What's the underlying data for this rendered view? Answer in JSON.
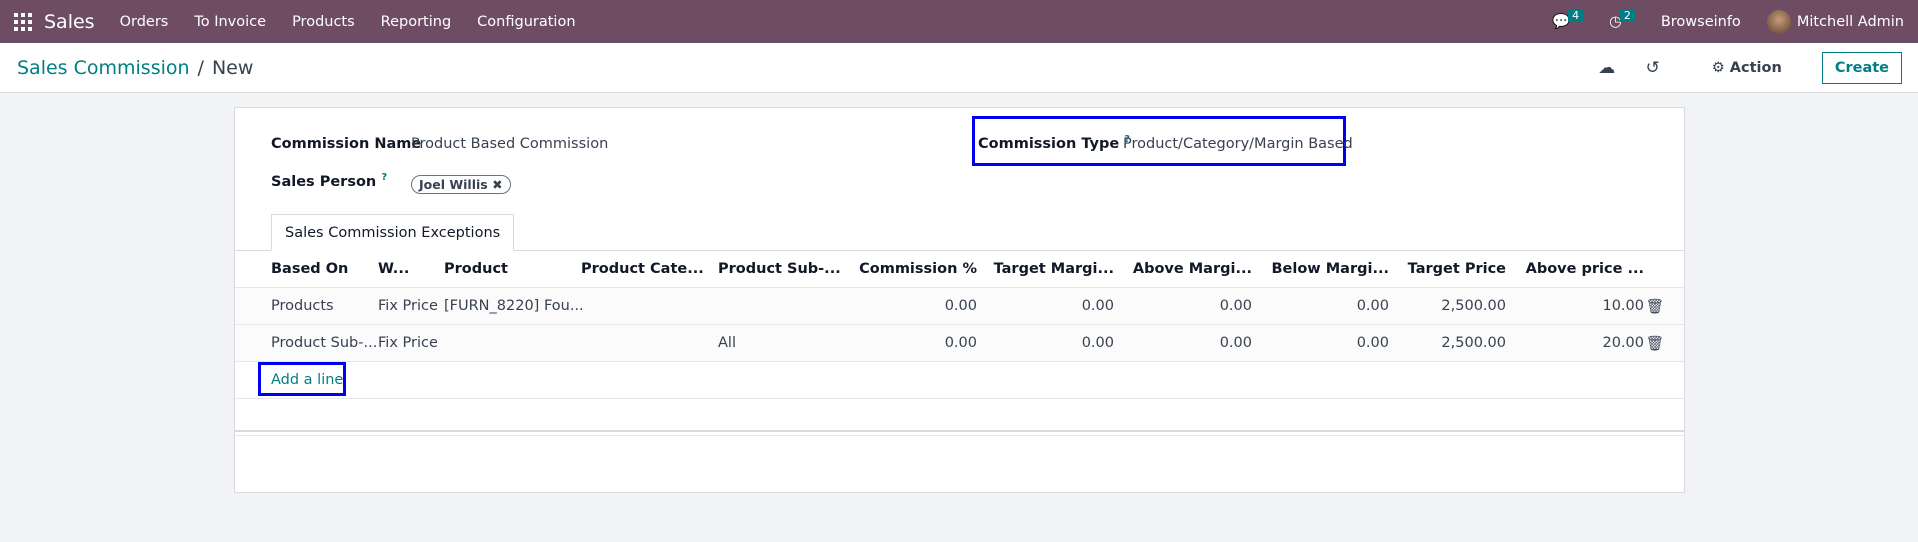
{
  "navbar": {
    "app": "Sales",
    "menus": [
      "Orders",
      "To Invoice",
      "Products",
      "Reporting",
      "Configuration"
    ],
    "messages_count": "4",
    "activities_count": "2",
    "company": "Browseinfo",
    "user": "Mitchell Admin"
  },
  "breadcrumb": {
    "parent": "Sales Commission",
    "current": "New"
  },
  "toolbar": {
    "action": "Action",
    "create": "Create"
  },
  "form": {
    "commission_name_label": "Commission Name",
    "commission_name": "Product Based Commission",
    "sales_person_label": "Sales Person",
    "help": "?",
    "sales_person": "Joel Willis",
    "commission_type_label": "Commission Type",
    "commission_type": "Product/Category/Margin Based"
  },
  "tab": "Sales Commission Exceptions",
  "table": {
    "headers": [
      "Based On",
      "W...",
      "Product",
      "Product Cate...",
      "Product Sub-...",
      "Commission %",
      "Target Margi...",
      "Above Margi...",
      "Below Margi...",
      "Target Price",
      "Above price ..."
    ],
    "rows": [
      [
        "Products",
        "Fix Price",
        "[FURN_8220] Fou...",
        "",
        "",
        "0.00",
        "0.00",
        "0.00",
        "0.00",
        "2,500.00",
        "10.00"
      ],
      [
        "Product Sub-...",
        "Fix Price",
        "",
        "",
        "All",
        "0.00",
        "0.00",
        "0.00",
        "0.00",
        "2,500.00",
        "20.00"
      ]
    ],
    "add_line": "Add a line"
  }
}
